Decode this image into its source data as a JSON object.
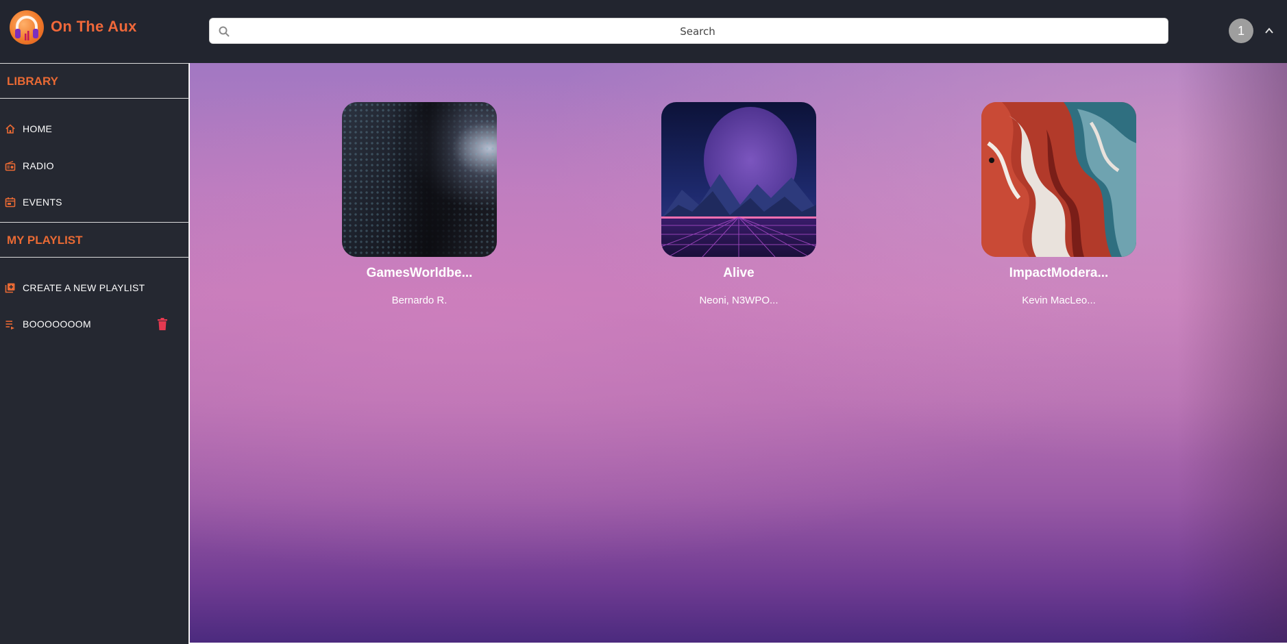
{
  "app": {
    "title": "On The Aux"
  },
  "search": {
    "placeholder": "Search"
  },
  "user": {
    "avatar_initial": "1"
  },
  "sidebar": {
    "library_title": "LIBRARY",
    "items": [
      {
        "label": "HOME",
        "icon": "home-icon"
      },
      {
        "label": "RADIO",
        "icon": "radio-icon"
      },
      {
        "label": "EVENTS",
        "icon": "calendar-icon"
      }
    ],
    "playlist_title": "MY PLAYLIST",
    "create_label": "CREATE A NEW PLAYLIST",
    "playlists": [
      {
        "label": "BOOOOOOOM",
        "icon": "playlist-icon",
        "action_icon": "trash-icon"
      }
    ]
  },
  "tracks": [
    {
      "title": "GamesWorldbe...",
      "artist": "Bernardo R."
    },
    {
      "title": "Alive",
      "artist": "Neoni, N3WPO..."
    },
    {
      "title": "ImpactModera...",
      "artist": "Kevin MacLeo..."
    }
  ],
  "colors": {
    "accent": "#EA6A34",
    "topbar": "#22252F",
    "sidebar": "#252831",
    "delete": "#E53950"
  }
}
